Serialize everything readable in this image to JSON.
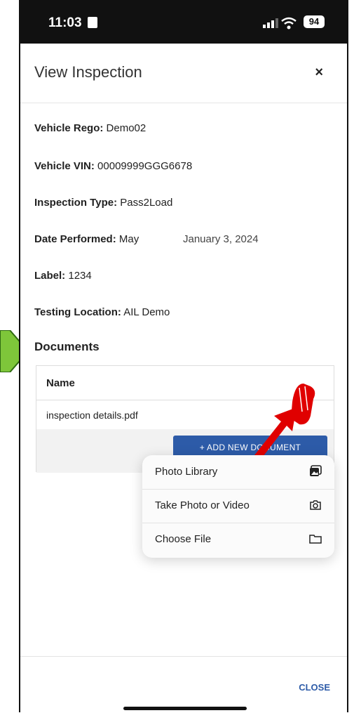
{
  "status_bar": {
    "time": "11:03",
    "battery": "94"
  },
  "dialog": {
    "title": "View Inspection",
    "close_x": "×"
  },
  "details": {
    "rego_label": "Vehicle Rego:",
    "rego_value": "Demo02",
    "vin_label": "Vehicle VIN:",
    "vin_value": "00009999GGG6678",
    "type_label": "Inspection Type:",
    "type_value": "Pass2Load",
    "date_label": "Date Performed:",
    "date_value": "May",
    "date_overlay": "January 3, 2024",
    "label_label": "Label:",
    "label_value": "1234",
    "location_label": "Testing Location:",
    "location_value": "AIL Demo"
  },
  "documents": {
    "title": "Documents",
    "column": "Name",
    "rows": [
      "inspection details.pdf"
    ],
    "add_button": "+ ADD NEW DOCUMENT"
  },
  "menu": {
    "items": [
      {
        "label": "Photo Library",
        "icon": "photo-library-icon"
      },
      {
        "label": "Take Photo or Video",
        "icon": "camera-icon"
      },
      {
        "label": "Choose File",
        "icon": "folder-icon"
      }
    ]
  },
  "footer": {
    "close_label": "CLOSE"
  }
}
